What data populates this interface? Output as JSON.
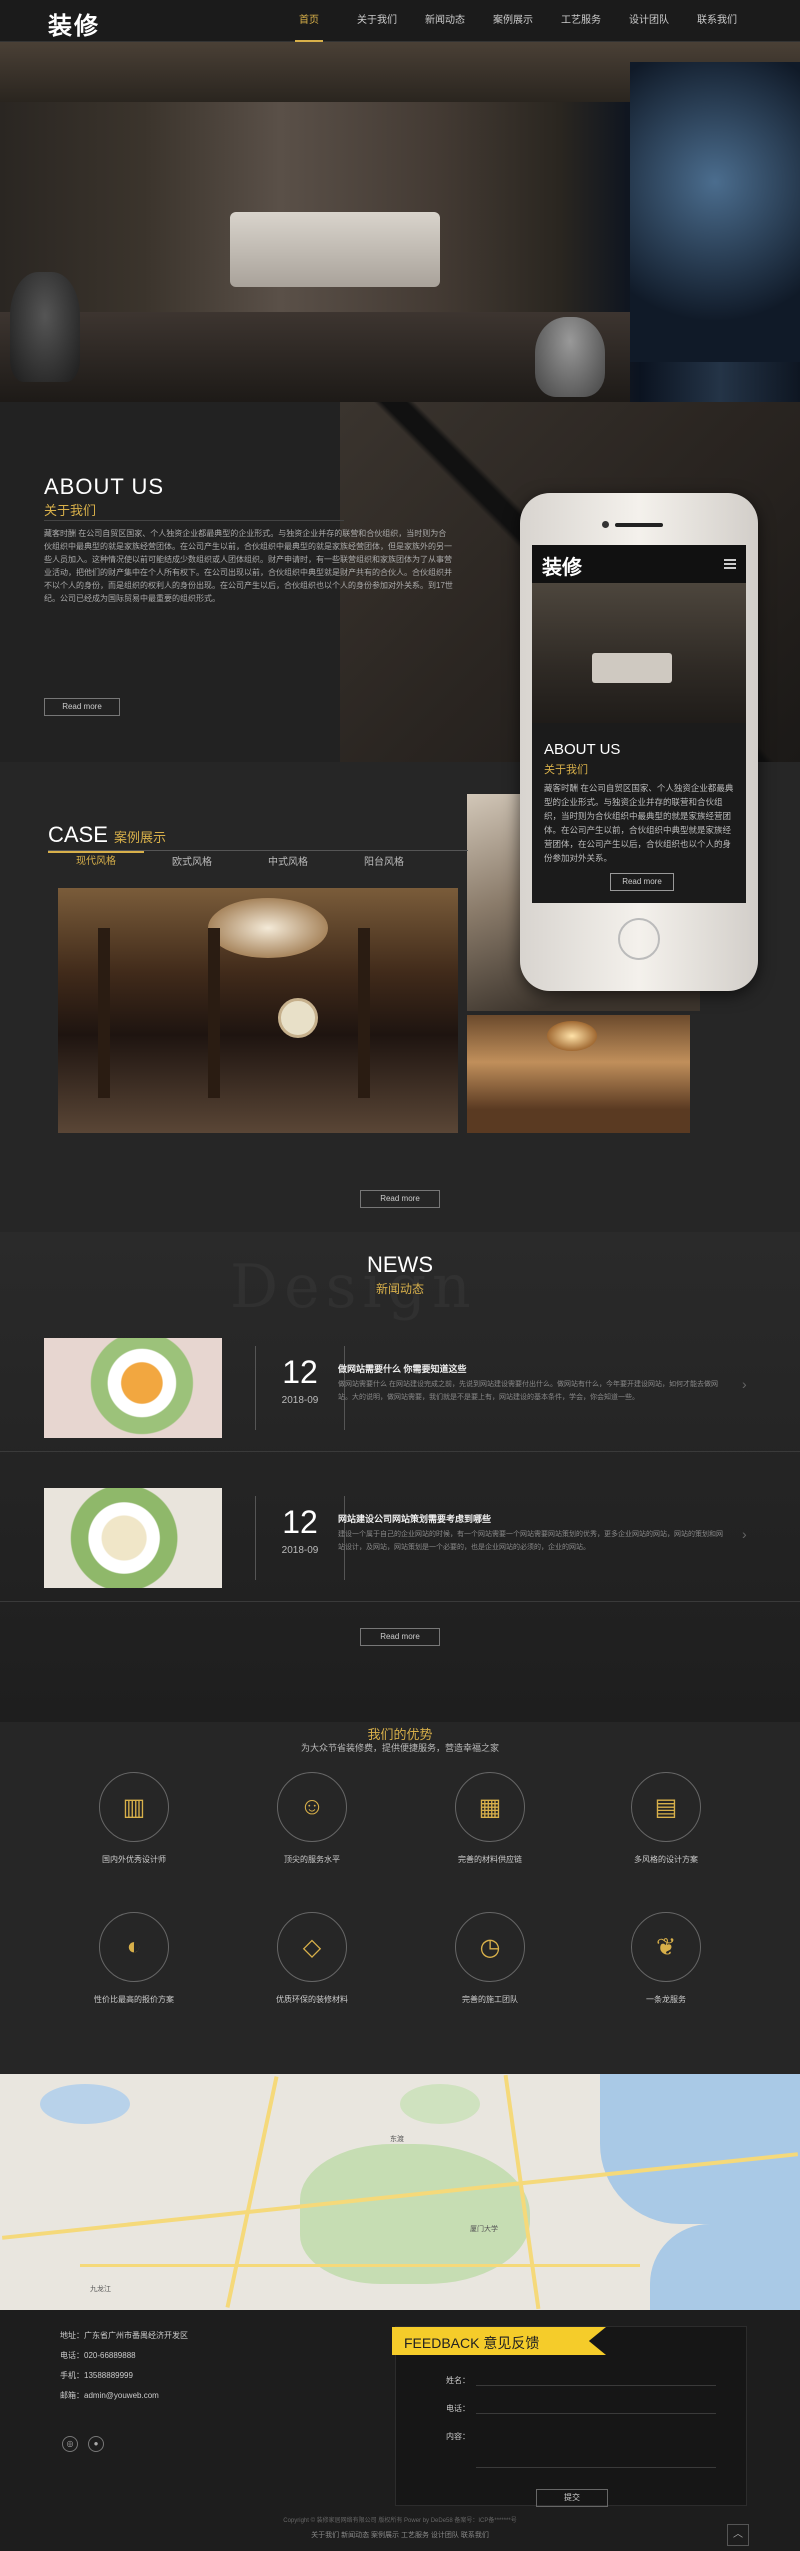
{
  "nav": {
    "logo": "装修",
    "items": [
      "首页",
      "关于我们",
      "新闻动态",
      "案例展示",
      "工艺服务",
      "设计团队",
      "联系我们"
    ],
    "active_index": 0
  },
  "hero": {
    "slides": 2,
    "active_slide": 1
  },
  "about": {
    "title": "ABOUT US",
    "subtitle": "关于我们",
    "text": "藏客时酬 在公司自贸区国家、个人独资企业都最典型的企业形式。与独资企业并存的联营和合伙组织，当时则为合伙组织中最典型的就是家族经营团体。在公司产生以前，合伙组织中最典型的就是家族经营团体，但是家族外的另一些人员加入。这种情况使以前可能结成少数组织或人团体组织。财产申请时，有一些联营组织和家族团体为了从事营业活动，把他们的财产集中在个人所有权下。在公司出现以前，合伙组织中典型就是财产共有的合伙人。合伙组织并不以个人的身份，而是组织的权利人的身份出现。在公司产生以后，合伙组织也以个人的身份参加对外关系。到17世纪。公司已经成为国际贸易中最重要的组织形式。",
    "read_more": "Read more"
  },
  "phone": {
    "logo": "装修",
    "title": "ABOUT US",
    "subtitle": "关于我们",
    "text": "藏客时酬 在公司自贸区国家、个人独资企业都最典型的企业形式。与独资企业并存的联营和合伙组织，当时则为合伙组织中最典型的就是家族经营团体。在公司产生以前，合伙组织中典型就是家族经营团体，在公司产生以后，合伙组织也以个人的身份参加对外关系。",
    "read_more": "Read more"
  },
  "case": {
    "title": "CASE",
    "subtitle": "案例展示",
    "tabs": [
      "现代风格",
      "欧式风格",
      "中式风格",
      "阳台风格"
    ],
    "active_tab": 0,
    "read_more": "Read more"
  },
  "news": {
    "watermark": "Design",
    "title": "NEWS",
    "subtitle": "新闻动态",
    "items": [
      {
        "day": "12",
        "month": "2018-09",
        "title": "做网站需要什么 你需要知道这些",
        "desc": "做网站需要什么 在网站建设完成之前，先说到网站建设需要付出什么。做网站有什么，今年要开建设网站，如何才能去做网站。大的说明，做网站需要，我们就是不是要上有，网站建设的基本条件，学会，你会知道一些。"
      },
      {
        "day": "12",
        "month": "2018-09",
        "title": "网站建设公司网站策划需要考虑到哪些",
        "desc": "建设一个属于自己的企业网站的时候，有一个网站需要一个网站需要网站策划的优秀，更多企业网站的网站，网站的策划和网站设计，及网站，网站策划是一个必要的，也是企业网站的必须的，企业的网站。"
      }
    ],
    "read_more": "Read more"
  },
  "advantages": {
    "title": "我们的优势",
    "subtitle": "为大众节省装修费，提供便捷服务，营造幸福之家",
    "items": [
      {
        "label": "国内外优秀设计师",
        "icon": "factory-icon",
        "glyph": "▥"
      },
      {
        "label": "顶尖的服务水平",
        "icon": "person-icon",
        "glyph": "☺"
      },
      {
        "label": "完善的材料供应链",
        "icon": "calendar-icon",
        "glyph": "▦"
      },
      {
        "label": "多风格的设计方案",
        "icon": "layers-icon",
        "glyph": "▤"
      },
      {
        "label": "性价比最高的报价方案",
        "icon": "bean-icon",
        "glyph": "◐"
      },
      {
        "label": "优质环保的装修材料",
        "icon": "diamond-icon",
        "glyph": "◇"
      },
      {
        "label": "完善的施工团队",
        "icon": "clock-icon",
        "glyph": "◷"
      },
      {
        "label": "一条龙服务",
        "icon": "leaf-icon",
        "glyph": "❦"
      }
    ]
  },
  "map": {
    "labels": [
      "厦门大学",
      "东渡",
      "九龙江"
    ]
  },
  "contact": {
    "address_label": "地址：",
    "address": "广东省广州市番禺经济开发区",
    "phone_label": "电话：",
    "phone": "020-66889888",
    "mobile_label": "手机：",
    "mobile": "13588889999",
    "email_label": "邮箱：",
    "email": "admin@youweb.com"
  },
  "feedback": {
    "title": "FEEDBACK 意见反馈",
    "name_label": "姓名：",
    "phone_label": "电话：",
    "content_label": "内容：",
    "submit": "提交"
  },
  "footer": {
    "copyright": "Copyright © 装修家居网络有限公司 版权所有 Power by DeDe58 备案号：ICP备*******号",
    "links": "关于我们 新闻动态 案例展示 工艺服务 设计团队 联系我们"
  },
  "colors": {
    "accent": "#d8b04a",
    "feedback_band": "#f5cc2a",
    "background": "#262626"
  }
}
